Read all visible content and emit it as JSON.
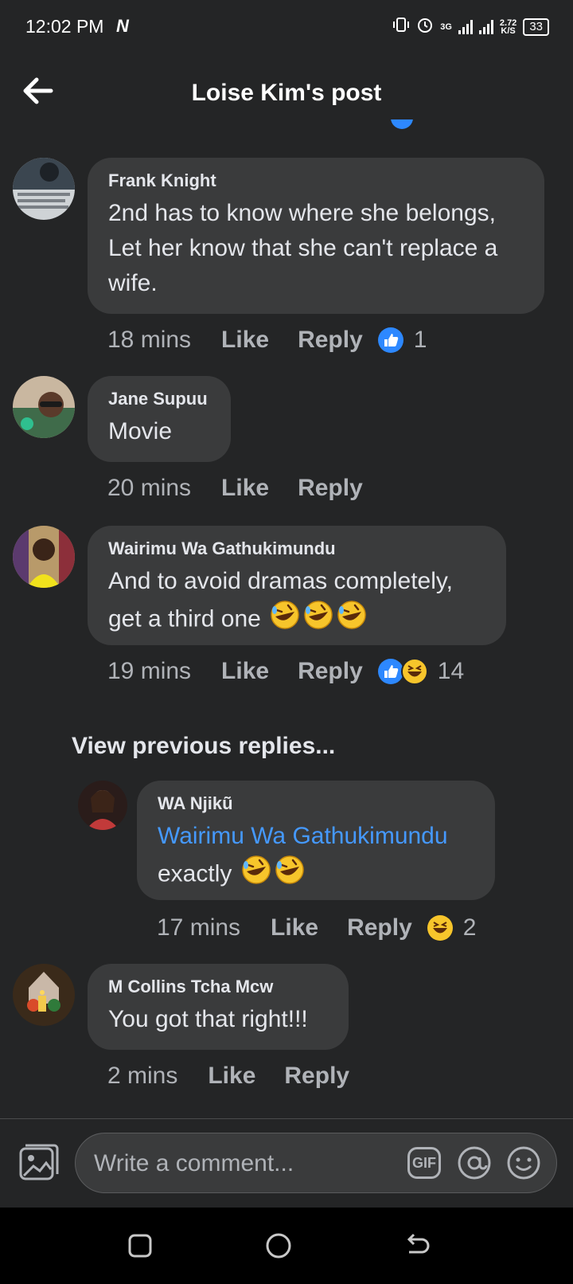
{
  "status_bar": {
    "time": "12:02 PM",
    "network": "3G",
    "speed_value": "2.72",
    "speed_unit": "K/S",
    "battery": "33"
  },
  "header": {
    "title": "Loise Kim's post",
    "back_icon": "arrow-left-icon"
  },
  "comments": [
    {
      "author": "Frank Knight",
      "text": "2nd has to know where she belongs, Let her know that she can't replace a wife.",
      "time": "18 mins",
      "like": "Like",
      "reply": "Reply",
      "reactions": [
        "like"
      ],
      "reaction_count": "1"
    },
    {
      "author": "Jane Supuu",
      "text": "Movie",
      "time": "20 mins",
      "like": "Like",
      "reply": "Reply",
      "reactions": [],
      "reaction_count": ""
    },
    {
      "author": "Wairimu Wa Gathukimundu",
      "text_line1": "And to avoid dramas completely,",
      "text_line2": "get a third one",
      "emojis": [
        "rofl",
        "rofl",
        "rofl"
      ],
      "time": "19 mins",
      "like": "Like",
      "reply": "Reply",
      "reactions": [
        "like",
        "haha"
      ],
      "reaction_count": "14"
    }
  ],
  "view_previous": "View previous replies...",
  "reply": {
    "author": "WA Njikũ",
    "mention": "Wairimu Wa Gathukimundu",
    "text": "exactly",
    "emojis": [
      "rofl",
      "rofl"
    ],
    "time": "17 mins",
    "like": "Like",
    "reply": "Reply",
    "reactions": [
      "haha"
    ],
    "reaction_count": "2"
  },
  "last_comment": {
    "author": "M Collins Tcha Mcw",
    "text": "You got that right!!!",
    "time": "2 mins",
    "like": "Like",
    "reply": "Reply"
  },
  "composer": {
    "placeholder": "Write a comment...",
    "gif_label": "GIF"
  },
  "nav": [
    "recents-icon",
    "home-icon",
    "back-icon"
  ],
  "colors": {
    "background": "#242526",
    "bubble": "#3a3b3c",
    "accent_blue": "#4599ff",
    "like_blue": "#2d88ff",
    "haha_yellow": "#f7c52b"
  }
}
